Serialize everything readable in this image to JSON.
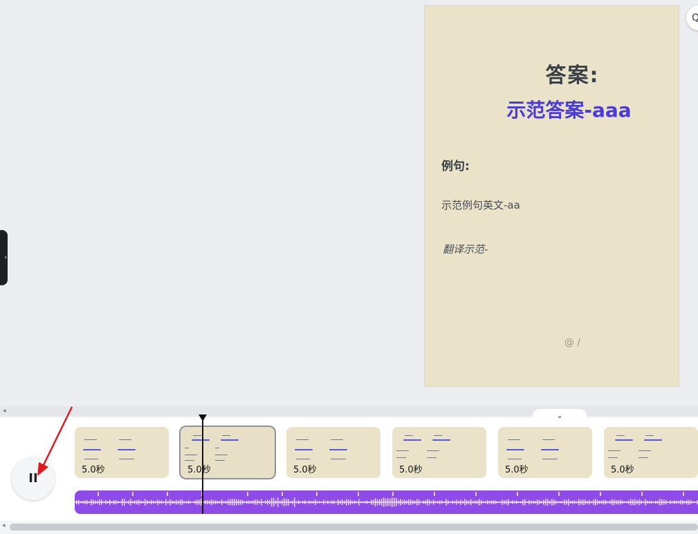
{
  "card": {
    "title": "答案:",
    "answer": "示范答案-aaa",
    "example_label": "例句:",
    "example_en": "示范例句英文-aa",
    "example_translation": "翻译示范-",
    "footer": "@ /"
  },
  "controls": {
    "pause_icon": "pause-icon",
    "pause_glyph": "II",
    "collapse_glyph": "⌄",
    "zoom_glyph": "Q",
    "side_handle_glyph": "›",
    "scroll_left_glyph": "◂"
  },
  "timeline": {
    "clips": [
      {
        "duration": "5.0秒"
      },
      {
        "duration": "5.0秒"
      },
      {
        "duration": "5.0秒"
      },
      {
        "duration": "5.0秒"
      },
      {
        "duration": "5.0秒"
      },
      {
        "duration": "5.0秒"
      }
    ],
    "audio_color": "#8f4be8"
  },
  "colors": {
    "accent": "#4a3ad6",
    "card_bg": "#ebe3c9",
    "annotation_arrow": "#e0191e"
  }
}
